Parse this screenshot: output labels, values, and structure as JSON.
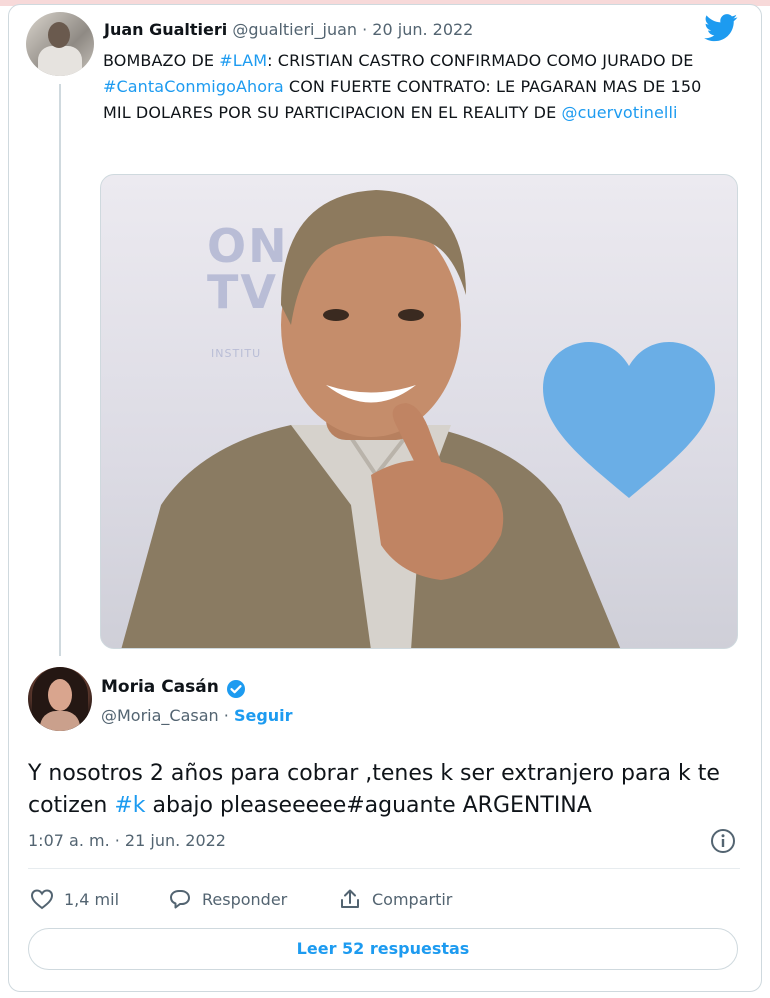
{
  "original_tweet": {
    "author_name": "Juan Gualtieri",
    "author_handle": "@gualtieri_juan",
    "date": "20 jun. 2022",
    "text_parts": [
      {
        "text": "BOMBAZO DE ",
        "link": false
      },
      {
        "text": "#LAM",
        "link": true
      },
      {
        "text": ": CRISTIAN CASTRO CONFIRMADO COMO JURADO DE ",
        "link": false
      },
      {
        "text": "#CantaConmigoAhora",
        "link": true
      },
      {
        "text": " CON FUERTE CONTRATO: LE PAGARAN MAS DE 150 MIL DOLARES POR SU PARTICIPACION EN EL REALITY DE ",
        "link": false
      },
      {
        "text": "@cuervotinelli",
        "link": true
      }
    ],
    "media_logo_text": "ON\nTV",
    "media_logo_sub": "INSTITU"
  },
  "reply_tweet": {
    "author_name": "Moria Casán",
    "author_handle": "@Moria_Casan",
    "follow_label": "Seguir",
    "text_parts": [
      {
        "text": "Y nosotros 2 años para cobrar ,tenes k ser extranjero para k te cotizen ",
        "link": false
      },
      {
        "text": "#k",
        "link": true
      },
      {
        "text": " abajo pleaseeeee#aguante ARGENTINA",
        "link": false
      }
    ],
    "timestamp": "1:07 a. m. · 21 jun. 2022"
  },
  "actions": {
    "like_count": "1,4 mil",
    "reply_label": "Responder",
    "share_label": "Compartir"
  },
  "read_replies_label": "Leer 52 respuestas",
  "colors": {
    "accent": "#1d9bf0",
    "secondary_text": "#536471",
    "heart": "#6aaee6",
    "border": "#cfd9de"
  },
  "icons": [
    "twitter-bird-icon",
    "verified-badge-icon",
    "info-icon",
    "heart-icon",
    "reply-icon",
    "share-icon"
  ]
}
